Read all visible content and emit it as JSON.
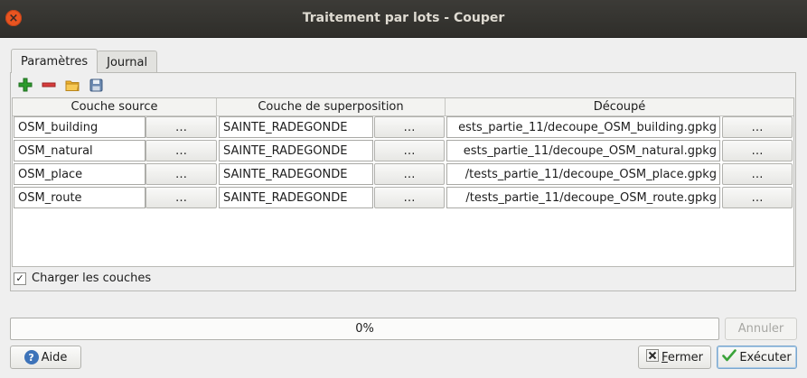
{
  "window": {
    "title": "Traitement par lots - Couper",
    "close_icon": "close-icon"
  },
  "tabs": [
    {
      "label": "Paramètres",
      "active": true
    },
    {
      "label": "Journal",
      "active": false
    }
  ],
  "toolbar": {
    "icons": [
      "add-row-icon",
      "remove-row-icon",
      "open-folder-icon",
      "save-icon"
    ]
  },
  "table": {
    "columns": [
      "Couche source",
      "Couche de superposition",
      "Découpé"
    ],
    "browse_label": "…",
    "rows": [
      {
        "source": "OSM_building",
        "overlay": "SAINTE_RADEGONDE",
        "output": "ests_partie_11/decoupe_OSM_building.gpkg"
      },
      {
        "source": "OSM_natural",
        "overlay": "SAINTE_RADEGONDE",
        "output": "ests_partie_11/decoupe_OSM_natural.gpkg"
      },
      {
        "source": "OSM_place",
        "overlay": "SAINTE_RADEGONDE",
        "output": "/tests_partie_11/decoupe_OSM_place.gpkg"
      },
      {
        "source": "OSM_route",
        "overlay": "SAINTE_RADEGONDE",
        "output": "/tests_partie_11/decoupe_OSM_route.gpkg"
      }
    ]
  },
  "load_layers": {
    "label": "Charger les couches",
    "checked": true,
    "mark": "✓"
  },
  "progress": {
    "value": 0,
    "text": "0%"
  },
  "buttons": {
    "cancel": "Annuler",
    "help": "Aide",
    "close_prefix": "F",
    "close_rest": "ermer",
    "run": "Exécuter"
  },
  "colors": {
    "titlebar": "#3c3b37",
    "close": "#e95420",
    "add": "#2e9b2e",
    "remove": "#d63c3c",
    "folder": "#f0b22e",
    "save": "#6b89b0"
  }
}
